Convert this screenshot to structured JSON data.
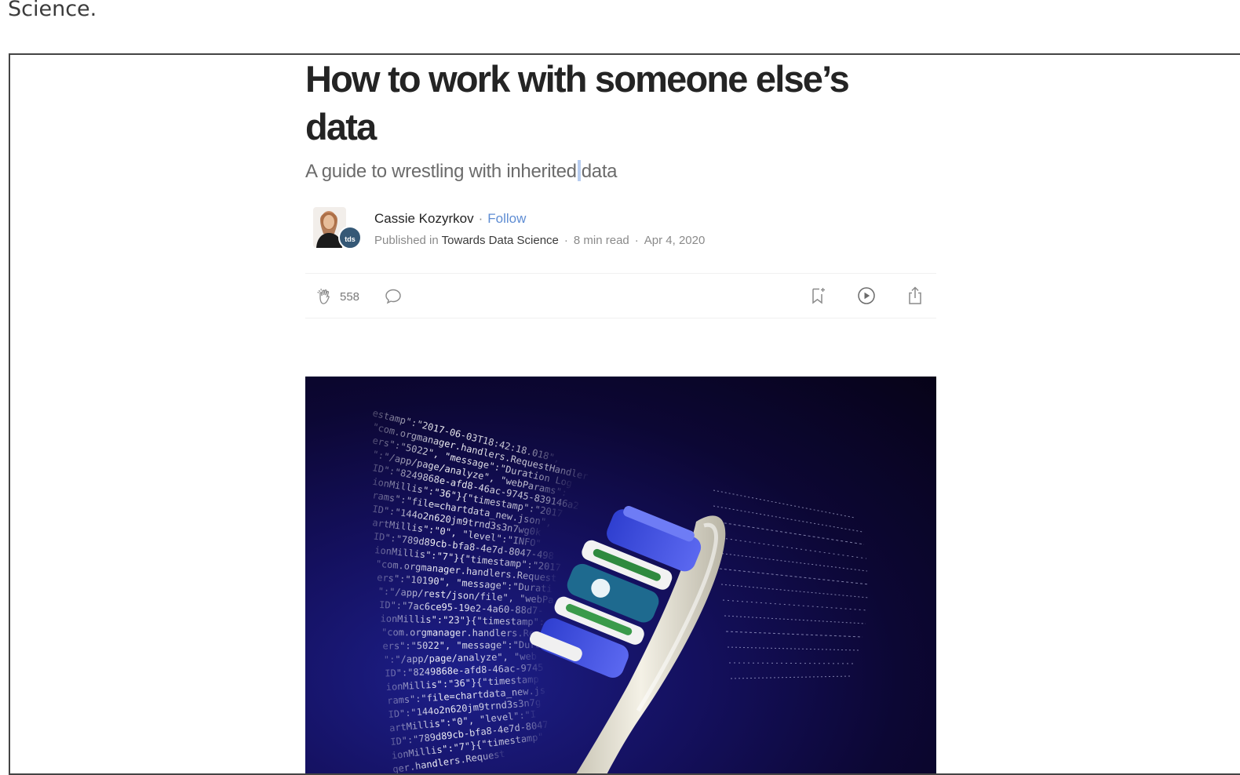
{
  "intro": {
    "text": "Science."
  },
  "article": {
    "title": "How to work with someone else’s data",
    "subtitle_before": "A guide to wrestling with inherited",
    "subtitle_after": "data",
    "author": "Cassie Kozyrkov",
    "follow_label": "Follow",
    "published_in_label": "Published in",
    "publication": "Towards Data Science",
    "read_time": "8 min read",
    "date": "Apr 4, 2020",
    "publication_badge": "tds",
    "clap_count": "558",
    "icons": {
      "clap": "clap-icon",
      "comment": "comment-icon",
      "bookmark": "bookmark-add-icon",
      "listen": "play-circle-icon",
      "share": "share-icon"
    }
  },
  "hero_image": {
    "code_lines": [
      "estamp\":\"2017-06-03T18:42:18.018\",",
      "\"com.orgmanager.handlers.RequestHandler",
      "ers\":\"5022\", \"message\":\"Duration Log",
      "\":\"/app/page/analyze\", \"webParams\":",
      "ID\":\"8249868e-afd8-46ac-9745-839146a2",
      "ionMillis\":\"36\"}{\"timestamp\":\"2017",
      "rams\":\"file=chartdata_new.json\",",
      "ID\":\"144o2n620jm9trnd3s3n7wg0k",
      "artMillis\":\"0\", \"level\":\"INFO\"",
      "ID\":\"789d89cb-bfa8-4e7d-8047-498",
      "ionMillis\":\"7\"}{\"timestamp\":\"2017",
      "\"com.orgmanager.handlers.Request",
      "ers\":\"10190\", \"message\":\"Durati",
      "\":\"/app/rest/json/file\", \"webPa",
      "ID\":\"7ac6ce95-19e2-4a60-88d7-",
      "ionMillis\":\"23\"}{\"timestamp\":",
      "\"com.orgmanager.handlers.Re",
      "ers\":\"5022\", \"message\":\"Dura",
      "\":\"/app/page/analyze\", \"web",
      "ID\":\"8249868e-afd8-46ac-9745",
      "ionMillis\":\"36\"}{\"timestamp",
      "rams\":\"file=chartdata_new.js",
      "ID\":\"144o2n620jm9trnd3s3n7g",
      "artMillis\":\"0\", \"level\":\"I",
      "ID\":\"789d89cb-bfa8-4e7d-8047",
      "ionMillis\":\"7\"}{\"timestamp\"",
      "ger.handlers.Request"
    ]
  }
}
